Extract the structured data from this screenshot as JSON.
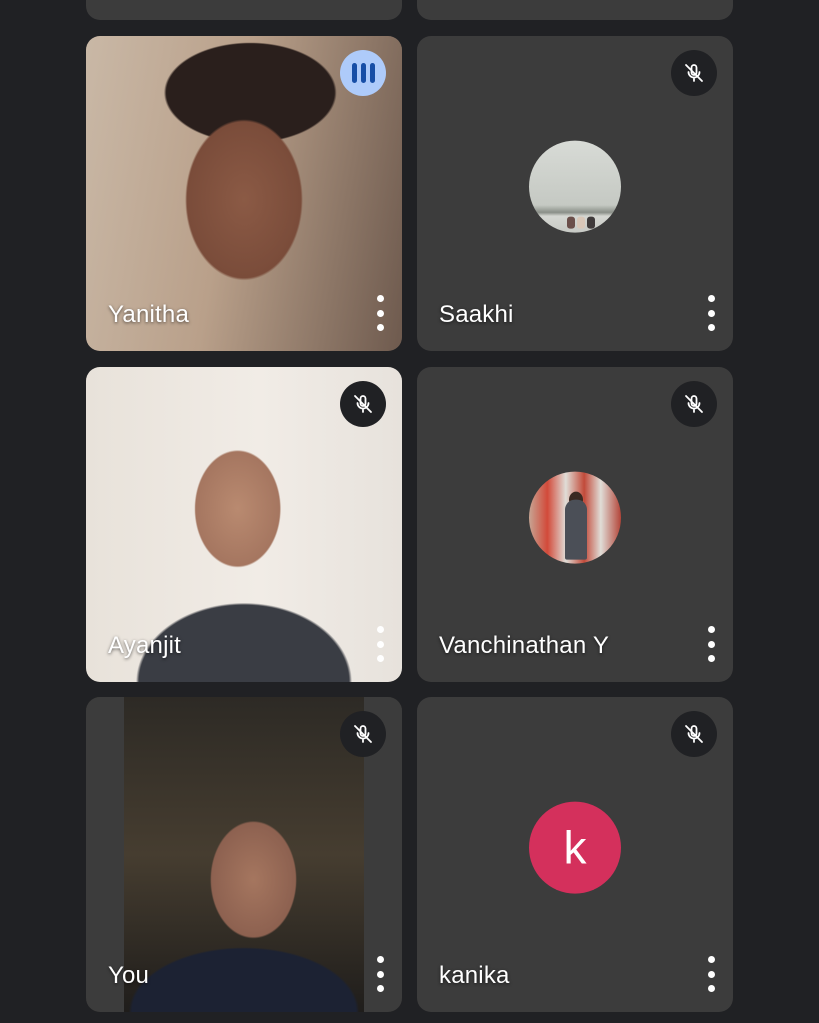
{
  "participants": [
    {
      "name": "Yanitha",
      "status": "speaking",
      "status_icon": "audio-level-icon",
      "display": "video"
    },
    {
      "name": "Saakhi",
      "status": "muted",
      "status_icon": "mic-off-icon",
      "display": "profile-photo"
    },
    {
      "name": "Ayanjit",
      "status": "muted",
      "status_icon": "mic-off-icon",
      "display": "video"
    },
    {
      "name": "Vanchinathan Y",
      "status": "muted",
      "status_icon": "mic-off-icon",
      "display": "profile-photo"
    },
    {
      "name": "You",
      "status": "muted",
      "status_icon": "mic-off-icon",
      "display": "video"
    },
    {
      "name": "kanika",
      "status": "muted",
      "status_icon": "mic-off-icon",
      "display": "initial-avatar",
      "initial": "k",
      "avatar_color": "#d4305c"
    }
  ],
  "colors": {
    "background": "#202124",
    "tile": "#3c3c3c",
    "speaking_badge": "#aecbfa",
    "speaking_bars": "#174ea6"
  }
}
